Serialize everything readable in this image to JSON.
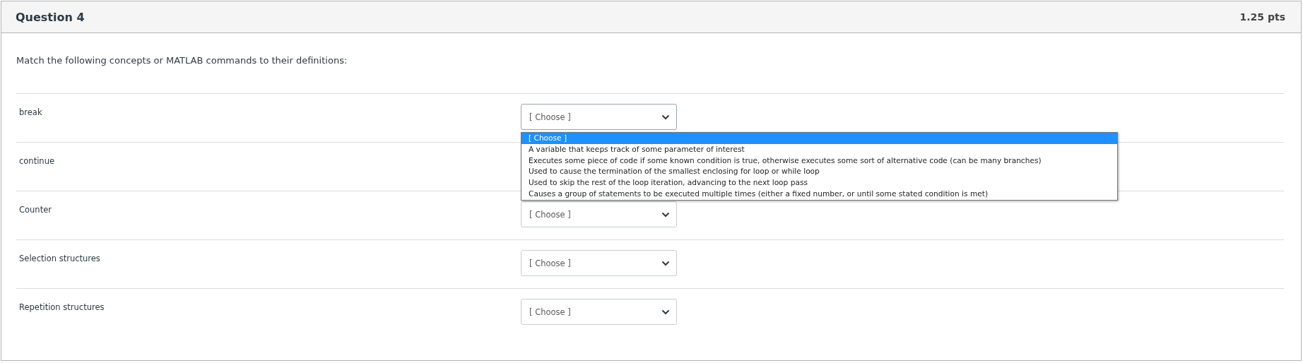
{
  "question": {
    "title": "Question 4",
    "points": "1.25 pts"
  },
  "prompt": "Match the following concepts or MATLAB commands to their definitions:",
  "rows": [
    {
      "label": "break",
      "select": {
        "value": "[ Choose ]",
        "expanded": true
      }
    },
    {
      "label": "continue"
    },
    {
      "label": "Counter",
      "select": {
        "value": "[ Choose ]",
        "expanded": false
      }
    },
    {
      "label": "Selection structures",
      "select": {
        "value": "[ Choose ]",
        "expanded": false
      }
    },
    {
      "label": "Repetition structures",
      "select": {
        "value": "[ Choose ]",
        "expanded": false
      }
    }
  ],
  "dropdown_options": [
    {
      "label": "[ Choose ]",
      "selected": true
    },
    {
      "label": "A variable that keeps track of some parameter of interest",
      "selected": false
    },
    {
      "label": "Executes some piece of code if some known condition is true, otherwise executes some sort of alternative code (can be many branches)",
      "selected": false
    },
    {
      "label": "Used to cause the termination of the smallest enclosing for loop or while loop",
      "selected": false
    },
    {
      "label": "Used to skip the rest of the loop iteration, advancing to the next loop pass",
      "selected": false
    },
    {
      "label": "Causes a group of statements to be executed multiple times (either a fixed number, or until some stated condition is met)",
      "selected": false
    }
  ]
}
